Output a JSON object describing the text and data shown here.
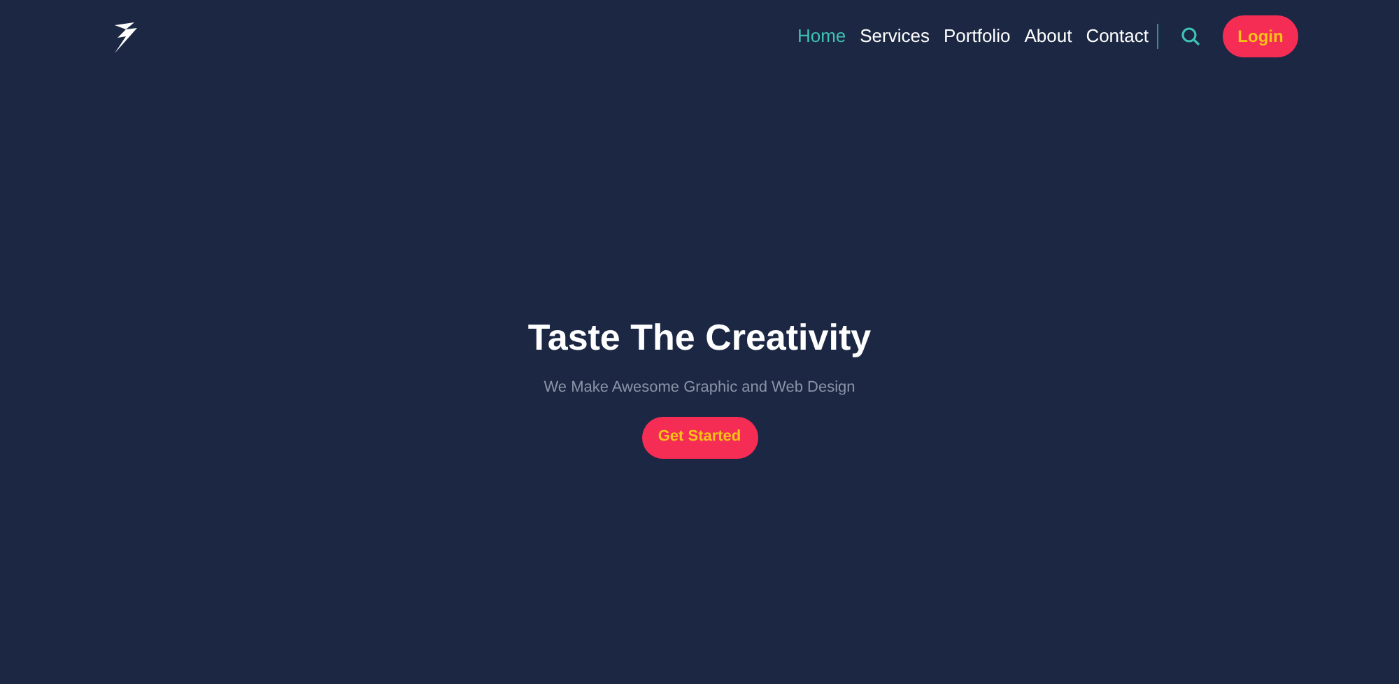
{
  "nav": {
    "items": [
      {
        "label": "Home",
        "selected": true
      },
      {
        "label": "Services",
        "selected": false
      },
      {
        "label": "Portfolio",
        "selected": false
      },
      {
        "label": "About",
        "selected": false
      },
      {
        "label": "Contact",
        "selected": false
      }
    ],
    "login": "Login"
  },
  "hero": {
    "title": "Taste The Creativity",
    "subtitle": "We Make Awesome Graphic and Web Design",
    "button": "Get Started"
  }
}
